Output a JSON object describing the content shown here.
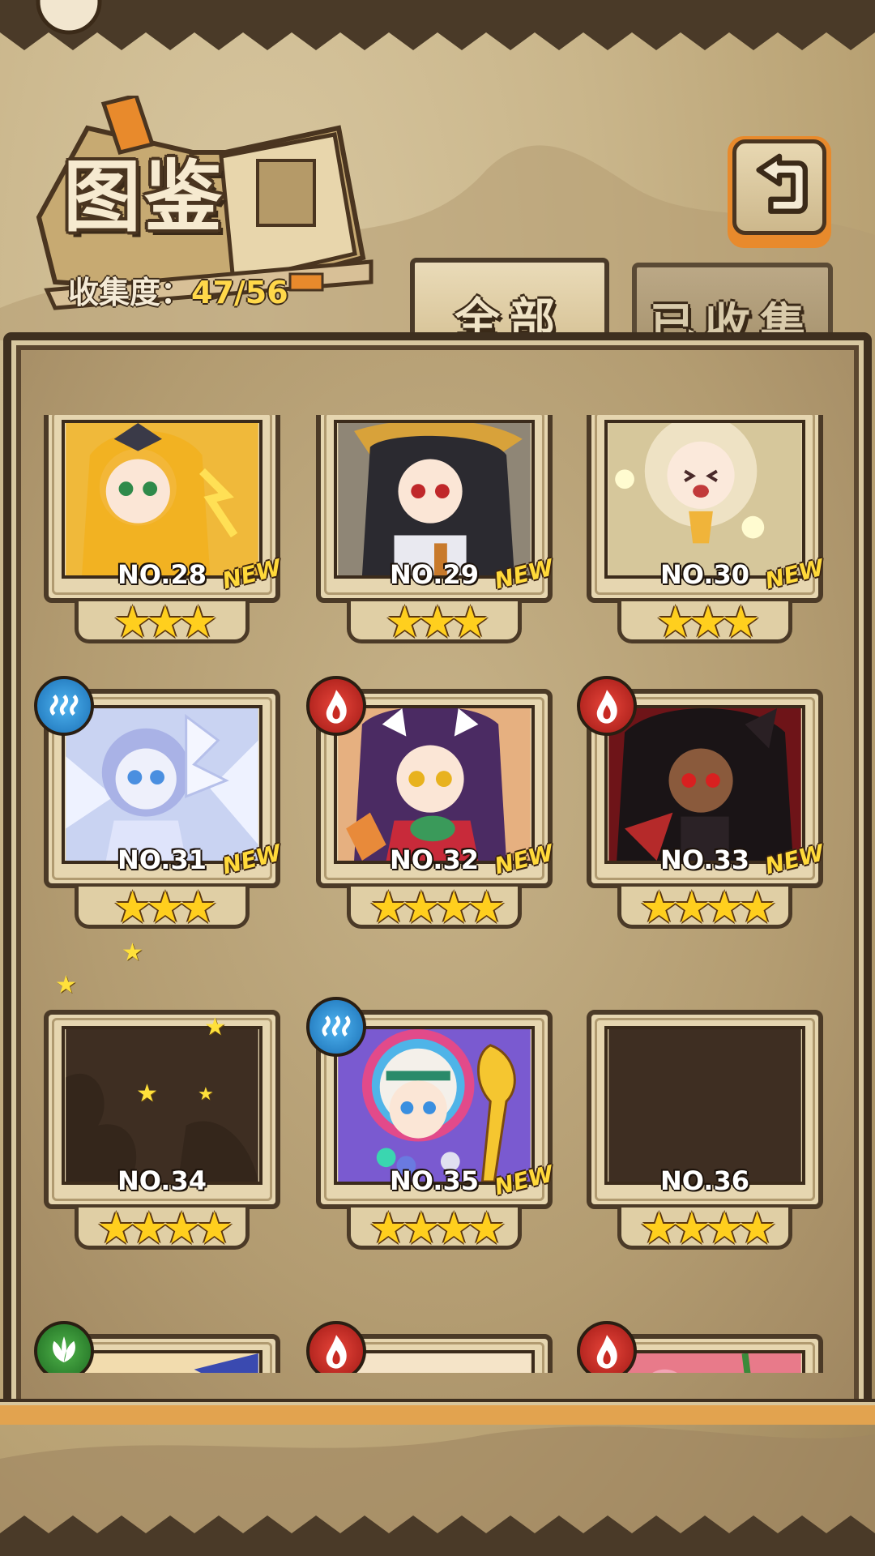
{
  "header": {
    "title": "图鉴",
    "collection_label": "收集度：",
    "collection_value": "47/56"
  },
  "tabs": [
    {
      "label": "全部",
      "active": true
    },
    {
      "label": "已收集",
      "active": false
    }
  ],
  "cards": [
    {
      "no": "NO.28",
      "stars": 3,
      "new": true,
      "element": null
    },
    {
      "no": "NO.29",
      "stars": 3,
      "new": true,
      "element": null
    },
    {
      "no": "NO.30",
      "stars": 3,
      "new": true,
      "element": null
    },
    {
      "no": "NO.31",
      "stars": 3,
      "new": true,
      "element": "water"
    },
    {
      "no": "NO.32",
      "stars": 4,
      "new": true,
      "element": "fire"
    },
    {
      "no": "NO.33",
      "stars": 4,
      "new": true,
      "element": "fire"
    },
    {
      "no": "NO.34",
      "stars": 4,
      "new": false,
      "element": null,
      "locked": true
    },
    {
      "no": "NO.35",
      "stars": 4,
      "new": true,
      "element": "water"
    },
    {
      "no": "NO.36",
      "stars": 4,
      "new": false,
      "element": null,
      "locked": true
    }
  ],
  "new_label": "NEW",
  "star_glyph": "★",
  "partial_row_elements": [
    "leaf",
    "fire",
    "fire"
  ],
  "colors": {
    "accent_orange": "#e88a2c",
    "star_yellow": "#ffcf1e",
    "frame_dark": "#4b3a27"
  }
}
